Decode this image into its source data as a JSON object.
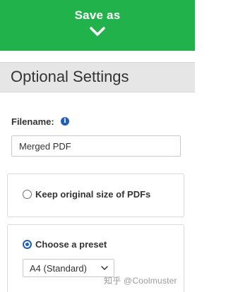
{
  "save_bar": {
    "title": "Save as",
    "icon": "chevron-down-icon",
    "color": "#22b24c"
  },
  "settings": {
    "title": "Optional Settings"
  },
  "filename": {
    "label": "Filename:",
    "info_icon": "info-icon",
    "value": "Merged PDF"
  },
  "options": {
    "keep_original": {
      "label": "Keep original size of PDFs",
      "selected": false
    },
    "preset": {
      "label": "Choose a preset",
      "selected": true,
      "select_value": "A4 (Standard)"
    }
  },
  "watermark": {
    "text": "知乎 @Coolmuster"
  },
  "accent_color": "#1f5fb8"
}
